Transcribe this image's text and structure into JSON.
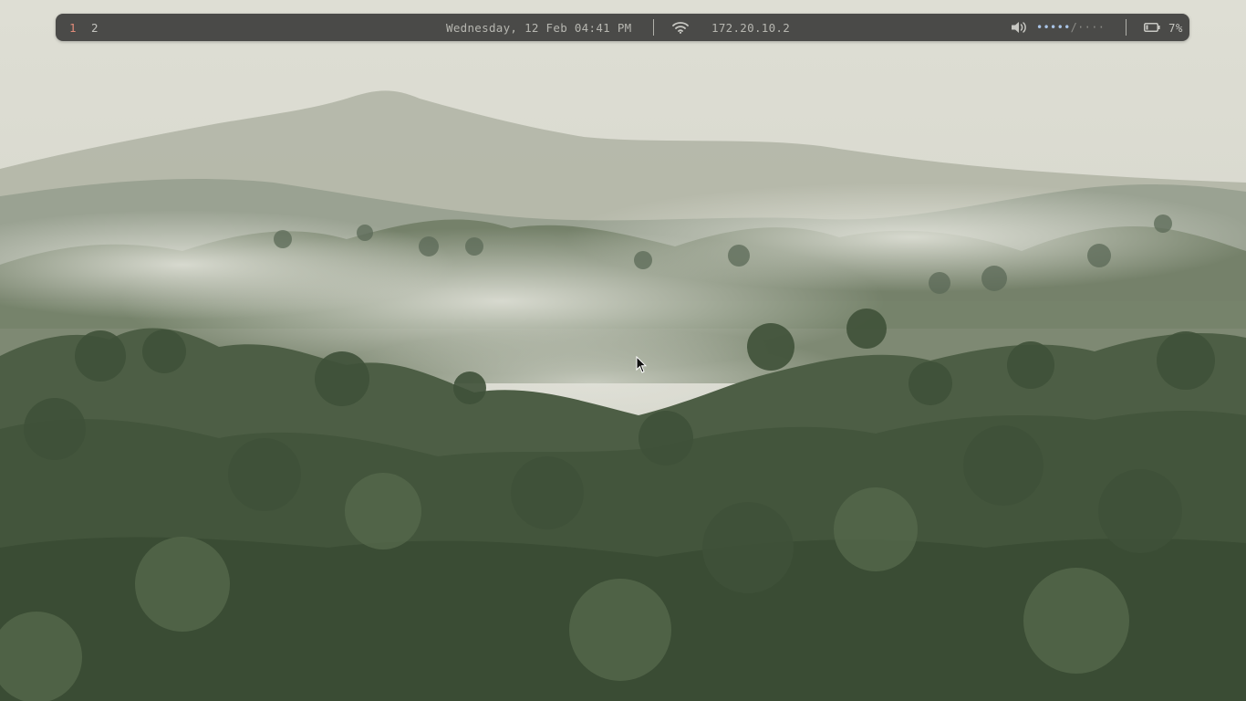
{
  "topbar": {
    "workspaces": [
      {
        "label": "1",
        "active": true
      },
      {
        "label": "2",
        "active": false
      }
    ],
    "clock": "Wednesday, 12 Feb 04:41 PM",
    "network": {
      "icon": "wifi-icon",
      "ip": "172.20.10.2"
    },
    "volume": {
      "icon": "speaker-icon",
      "level_filled": "•••••",
      "separator": "/",
      "level_empty": "····"
    },
    "battery": {
      "icon": "battery-icon",
      "percent": "7%"
    }
  },
  "colors": {
    "bar_bg": "#4a4a48",
    "active_workspace": "#e28c7a",
    "text": "#b9b9b4",
    "volume_accent": "#a9c4e6"
  },
  "wallpaper": {
    "description_icon": "misty-forest-wallpaper"
  }
}
